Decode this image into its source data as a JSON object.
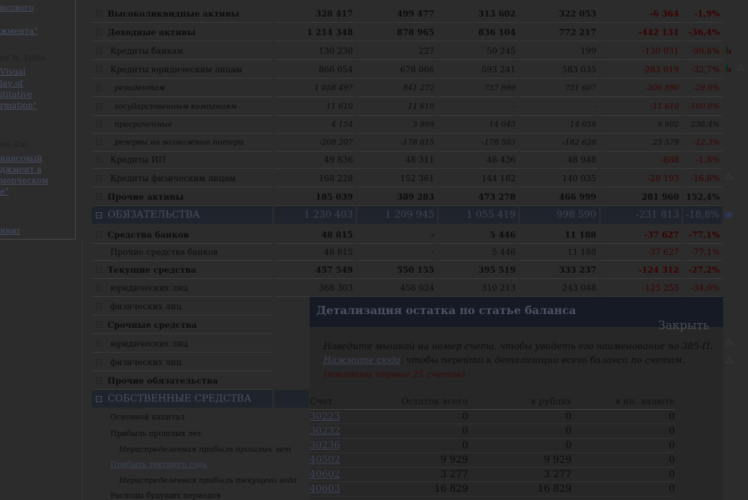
{
  "sidebar": {
    "items": [
      {
        "text": "нсового",
        "style": "link"
      },
      {
        "text": "жмента\"",
        "style": "link"
      },
      {
        "text": "rd R. Tufte",
        "style": "bold"
      },
      {
        "text": "Visual",
        "style": "link"
      },
      {
        "text": "lay of",
        "style": "link"
      },
      {
        "text": "ititative",
        "style": "link"
      },
      {
        "text": "rmation\"",
        "style": "link"
      },
      {
        "text": "ен Дж.",
        "style": "bold"
      },
      {
        "text": "нансовый",
        "style": "link"
      },
      {
        "text": "джмент в",
        "style": "link"
      },
      {
        "text": "мерческом",
        "style": "link"
      },
      {
        "text": "е\"",
        "style": "link"
      },
      {
        "text": "иниг",
        "style": "link"
      }
    ]
  },
  "rows": [
    {
      "type": "bold",
      "tog": "+",
      "label": "Высоколиквидные активы",
      "v": [
        "328 417",
        "499 477",
        "313 602",
        "322 053",
        "-6 364",
        "-1,9%"
      ]
    },
    {
      "type": "bold",
      "tog": "−",
      "label": "Доходные активы",
      "v": [
        "1 214 348",
        "878 965",
        "836 104",
        "772 217",
        "-442 131",
        "-36,4%"
      ]
    },
    {
      "type": "normal",
      "tog": "+",
      "label": "Кредиты банкам",
      "v": [
        "130 230",
        "227",
        "50 245",
        "199",
        "-130 031",
        "-99,8%"
      ],
      "icon": "bar-chart-icon"
    },
    {
      "type": "normal",
      "tog": "−",
      "label": "Кредиты юридическим лицам",
      "v": [
        "866 054",
        "678 066",
        "593 241",
        "583 035",
        "-283 019",
        "-32,7%"
      ],
      "icon": "bar-chart-icon",
      "icon2": "stars-icon"
    },
    {
      "type": "italic",
      "tog": "+",
      "label": "резидентам",
      "v": [
        "1 058 497",
        "841 272",
        "757 699",
        "751 607",
        "-306 890",
        "-29,0%"
      ]
    },
    {
      "type": "italic",
      "tog": "+",
      "label": "государственным компаниям",
      "v": [
        "11 610",
        "11 610",
        "-",
        "-",
        "-11 610",
        "-100,0%"
      ]
    },
    {
      "type": "italic",
      "tog": "+",
      "label": "просроченные",
      "v": [
        "4 154",
        "3 999",
        "14 045",
        "14 056",
        "9 902",
        "238,4%"
      ]
    },
    {
      "type": "italic",
      "tog": "+",
      "label": "резервы на возможные потери",
      "v": [
        "-208 207",
        "-178 815",
        "-178 503",
        "-182 628",
        "25 579",
        "-12,3%"
      ]
    },
    {
      "type": "normal",
      "tog": "+",
      "label": "Кредиты ИП",
      "v": [
        "49 836",
        "48 311",
        "48 436",
        "48 948",
        "-888",
        "-1,8%"
      ]
    },
    {
      "type": "normal",
      "tog": "+",
      "label": "Кредиты физическим лицам",
      "v": [
        "168 228",
        "152 361",
        "144 182",
        "140 035",
        "-28 193",
        "-16,8%"
      ],
      "icon": "stars-icon"
    },
    {
      "type": "bold",
      "tog": "+",
      "label": "Прочие активы",
      "v": [
        "185 039",
        "389 283",
        "473 278",
        "466 999",
        "281 960",
        "152,4%"
      ]
    },
    {
      "type": "header",
      "tog": "−",
      "label": "ОБЯЗАТЕЛЬСТВА",
      "v": [
        "1 230 403",
        "1 209 945",
        "1 055 419",
        "998 590",
        "-231 813",
        "-18,8%"
      ],
      "icon": "pie-chart-icon"
    },
    {
      "type": "bold",
      "tog": "−",
      "label": "Средства банков",
      "v": [
        "48 815",
        "-",
        "5 446",
        "11 188",
        "-37 627",
        "-77,1%"
      ]
    },
    {
      "type": "normal",
      "tog": "",
      "label": "Прочие средства банков",
      "v": [
        "48 815",
        "-",
        "5 446",
        "11 188",
        "-37 627",
        "-77,1%"
      ]
    },
    {
      "type": "bold",
      "tog": "−",
      "label": "Текущие средства",
      "v": [
        "457 549",
        "550 155",
        "395 519",
        "333 237",
        "-124 312",
        "-27,2%"
      ]
    },
    {
      "type": "normal",
      "tog": "+",
      "label": "юридических лиц",
      "v": [
        "368 303",
        "458 024",
        "310 213",
        "243 048",
        "-125 255",
        "-34,0%"
      ]
    },
    {
      "type": "normal",
      "tog": "+",
      "label": "физических лиц",
      "v": []
    },
    {
      "type": "bold",
      "tog": "−",
      "label": "Срочные средства",
      "v": []
    },
    {
      "type": "normal",
      "tog": "+",
      "label": "юридических лиц",
      "v": [],
      "icon": "stars-icon"
    },
    {
      "type": "normal",
      "tog": "+",
      "label": "физических лиц",
      "v": [],
      "icon": "stars-icon"
    },
    {
      "type": "bold",
      "tog": "+",
      "label": "Прочие обязательства",
      "v": []
    },
    {
      "type": "header",
      "tog": "−",
      "label": "СОБСТВЕННЫЕ СРЕДСТВА",
      "v": []
    },
    {
      "type": "small",
      "tog": "",
      "label": "Основной капитал",
      "v": []
    },
    {
      "type": "small",
      "tog": "",
      "label": "Прибыль прошлых лет",
      "v": []
    },
    {
      "type": "smallitalic",
      "tog": "",
      "label": "Нераспределенная прибыль прошлых лет",
      "v": []
    },
    {
      "type": "smalllink",
      "tog": "",
      "label": "Прибыль текущего года",
      "v": []
    },
    {
      "type": "smallitalic",
      "tog": "",
      "label": "Нераспределенная прибыль текущего года",
      "v": []
    },
    {
      "type": "small",
      "tog": "",
      "label": "Расходы будущих периодов",
      "v": []
    }
  ],
  "modal": {
    "title": "Детализация остатка по статье баланса",
    "close": "Закрыть",
    "line1": "Наведите мышкой на номер счета, чтобы увидеть его наименование по 385-П.",
    "line2_link": "Нажмите сюда",
    "line2_rest": ", чтобы перейти к детализации всего баланса по счетам.",
    "note": "(показаны первые 25 счетов)",
    "columns": [
      "Счет",
      "Остаток всего",
      "в рублях",
      "в ин. валюте"
    ],
    "accounts": [
      [
        "30223",
        "0",
        "0",
        "0"
      ],
      [
        "30232",
        "0",
        "0",
        "0"
      ],
      [
        "30236",
        "0",
        "0",
        "0"
      ],
      [
        "40502",
        "9 929",
        "9 929",
        "0"
      ],
      [
        "40602",
        "3 277",
        "3 277",
        "0"
      ],
      [
        "40603",
        "16 829",
        "16 829",
        "0"
      ]
    ]
  }
}
